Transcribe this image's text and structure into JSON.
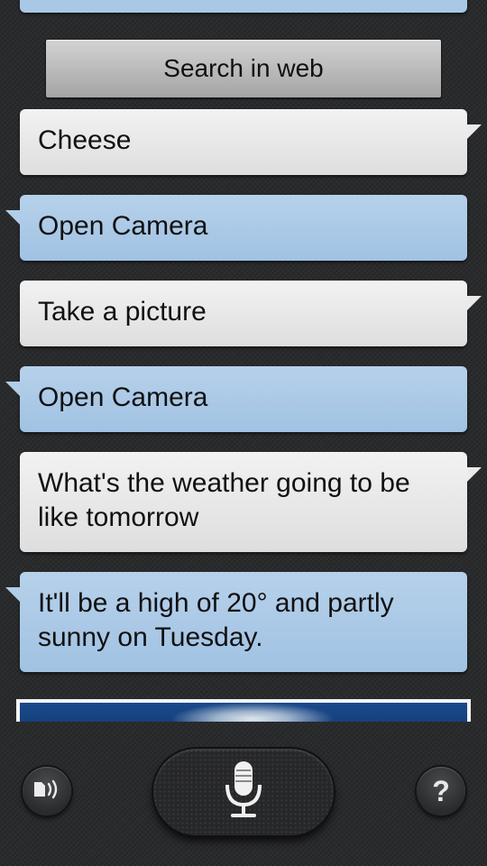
{
  "conversation": {
    "search_web_label": "Search in web",
    "messages": [
      {
        "role": "user",
        "text": "Cheese"
      },
      {
        "role": "assistant",
        "text": "Open Camera"
      },
      {
        "role": "user",
        "text": "Take a picture"
      },
      {
        "role": "assistant",
        "text": "Open Camera"
      },
      {
        "role": "user",
        "text": "What's the weather going to be like tomorrow"
      },
      {
        "role": "assistant",
        "text": "It'll be a high of 20° and partly sunny on Tuesday."
      }
    ]
  },
  "bottom_bar": {
    "tts_icon": "speaker-icon",
    "mic_icon": "microphone-icon",
    "help_label": "?"
  },
  "colors": {
    "background": "#2a2b2d",
    "user_bubble": "#e6e6e6",
    "assistant_bubble": "#a9c8e5",
    "button": "#bdbdbd"
  }
}
